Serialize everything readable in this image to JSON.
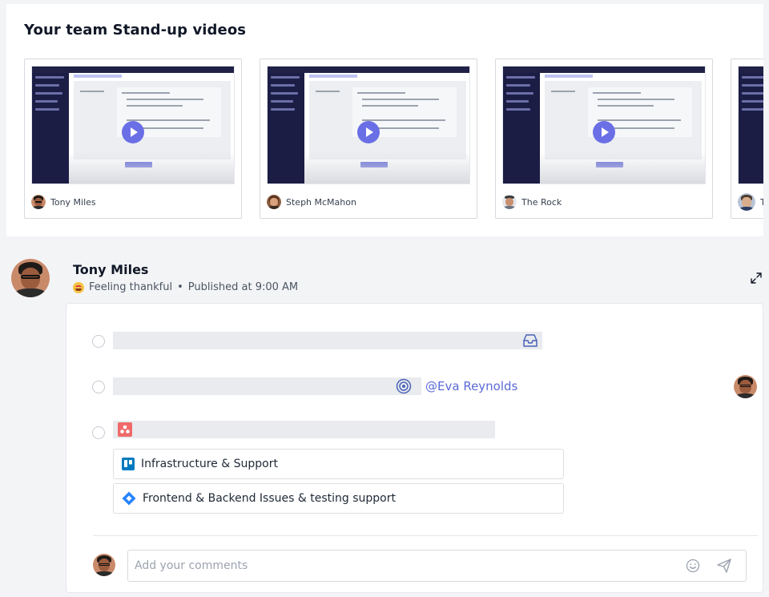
{
  "videos_section": {
    "title": "Your team Stand-up videos",
    "cards": [
      {
        "author": "Tony Miles",
        "avatar_icon": "avatar-glasses-man"
      },
      {
        "author": "Steph McMahon",
        "avatar_icon": "avatar-woman"
      },
      {
        "author": "The Rock",
        "avatar_icon": "avatar-man"
      },
      {
        "author": "To",
        "avatar_icon": "avatar-man-beard"
      }
    ]
  },
  "post": {
    "author": "Tony Miles",
    "mood": "Feeling thankful",
    "separator": "•",
    "published": "Published at 9:00 AM",
    "mention": "@Eva Reynolds",
    "links": [
      {
        "label": "Infrastructure & Support",
        "icon": "trello-icon"
      },
      {
        "label": "Frontend & Backend Issues & testing support",
        "icon": "jira-icon"
      }
    ],
    "comment": {
      "placeholder": "Add your comments",
      "value": ""
    }
  },
  "colors": {
    "accent": "#5b6ad6",
    "play": "#6a6fe6",
    "sidebar": "#1b1d45",
    "trello": "#0079bf",
    "jira": "#2684ff",
    "asana": "#f06a6a"
  }
}
